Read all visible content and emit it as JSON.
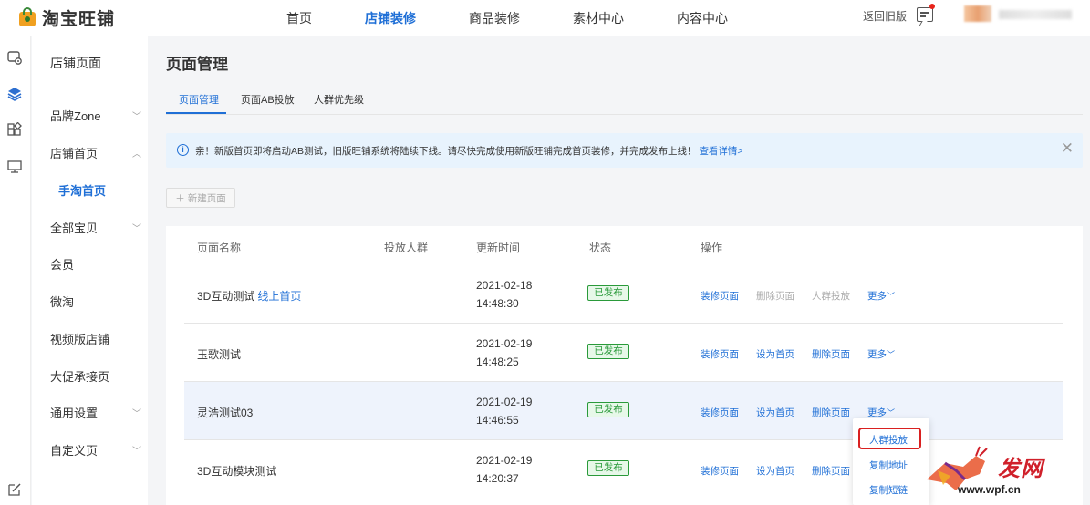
{
  "brand": {
    "name": "淘宝旺铺"
  },
  "topnav": {
    "items": [
      {
        "label": "首页"
      },
      {
        "label": "店铺装修"
      },
      {
        "label": "商品装修"
      },
      {
        "label": "素材中心"
      },
      {
        "label": "内容中心"
      }
    ],
    "active": "店铺装修",
    "back_old": "返回旧版"
  },
  "rail_icons": [
    "store-settings-icon",
    "layers-icon",
    "widgets-icon",
    "monitor-icon",
    "edit-icon"
  ],
  "sidebar": {
    "title": "店铺页面",
    "items": [
      {
        "label": "品牌Zone",
        "chevron": "down"
      },
      {
        "label": "店铺首页",
        "chevron": "up"
      },
      {
        "label": "手淘首页",
        "chevron": ""
      },
      {
        "label": "全部宝贝",
        "chevron": "down"
      },
      {
        "label": "会员",
        "chevron": ""
      },
      {
        "label": "微淘",
        "chevron": ""
      },
      {
        "label": "视频版店铺",
        "chevron": ""
      },
      {
        "label": "大促承接页",
        "chevron": ""
      },
      {
        "label": "通用设置",
        "chevron": "down"
      },
      {
        "label": "自定义页",
        "chevron": "down"
      }
    ]
  },
  "main": {
    "title": "页面管理",
    "tabs": [
      {
        "label": "页面管理"
      },
      {
        "label": "页面AB投放"
      },
      {
        "label": "人群优先级"
      }
    ],
    "notice": {
      "text": "亲！新版首页即将启动AB测试，旧版旺铺系统将陆续下线。请尽快完成使用新版旺铺完成首页装修，并完成发布上线！",
      "link": "查看详情>",
      "close": "✕"
    },
    "new_button": "新建页面"
  },
  "table": {
    "headers": [
      "页面名称",
      "投放人群",
      "更新时间",
      "状态",
      "操作"
    ],
    "rows": [
      {
        "name": "3D互动测试",
        "tag": "线上首页",
        "date": "2021-02-18",
        "time": "14:48:30",
        "status": "已发布",
        "actions": [
          "装修页面",
          "删除页面",
          "人群投放"
        ],
        "more": "更多"
      },
      {
        "name": "玉歌测试",
        "tag": "",
        "date": "2021-02-19",
        "time": "14:48:25",
        "status": "已发布",
        "actions": [
          "装修页面",
          "设为首页",
          "删除页面"
        ],
        "more": "更多"
      },
      {
        "name": "灵浩测试03",
        "tag": "",
        "date": "2021-02-19",
        "time": "14:46:55",
        "status": "已发布",
        "actions": [
          "装修页面",
          "设为首页",
          "删除页面"
        ],
        "more": "更多"
      },
      {
        "name": "3D互动模块测试",
        "tag": "",
        "date": "2021-02-19",
        "time": "14:20:37",
        "status": "已发布",
        "actions": [
          "装修页面",
          "设为首页",
          "删除页面"
        ],
        "more": ""
      }
    ]
  },
  "dropdown": {
    "options": [
      "人群投放",
      "复制地址",
      "复制短链"
    ],
    "highlighted": "人群投放"
  },
  "watermark": {
    "text": "发网",
    "url": "www.wpf.cn"
  },
  "colors": {
    "accent": "#1f6fd6",
    "success": "#2a9a3a",
    "notice_bg": "#e8f3fd",
    "highlight": "#d92020"
  }
}
